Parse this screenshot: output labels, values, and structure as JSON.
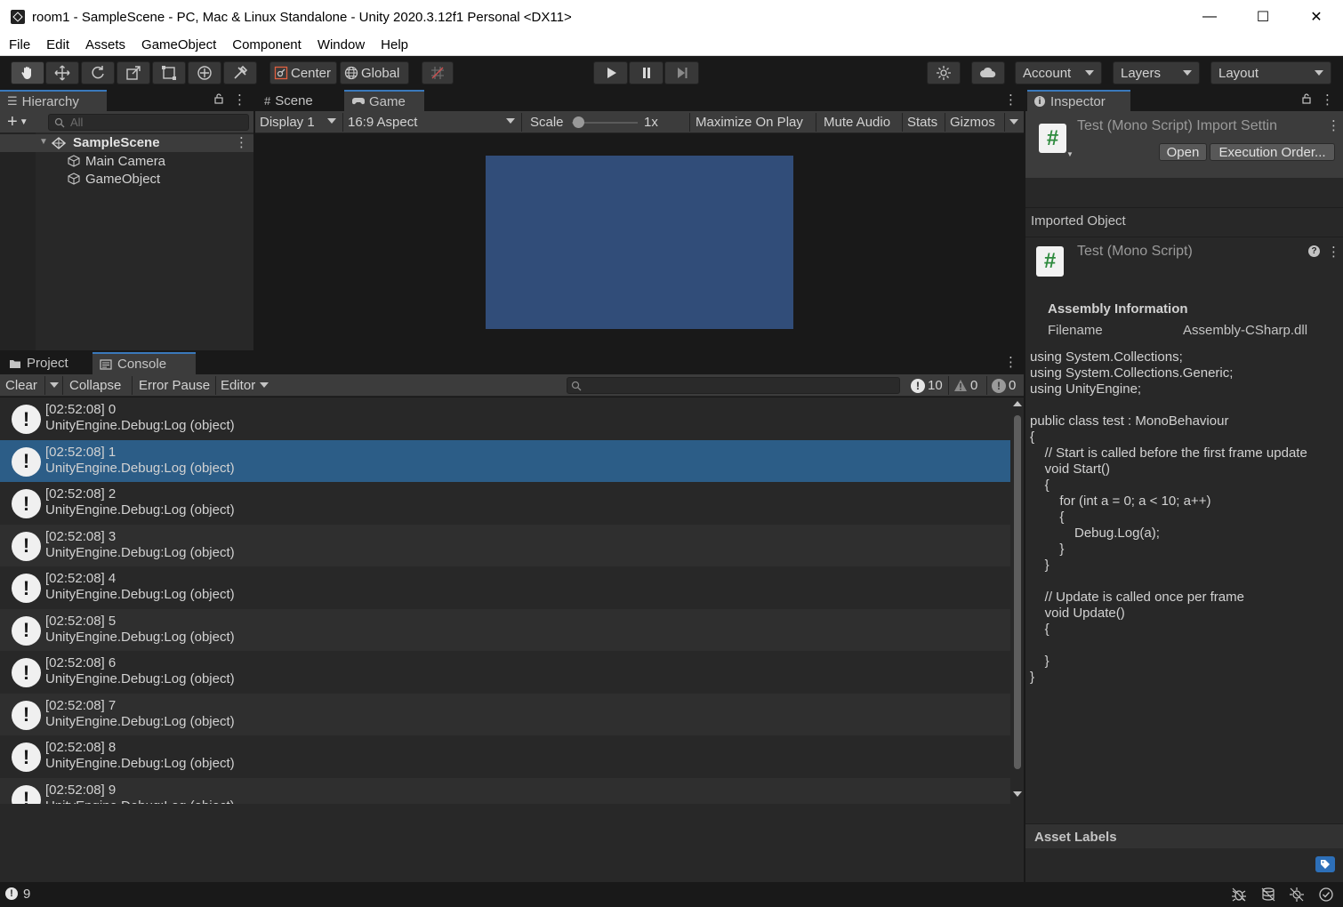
{
  "window": {
    "title": "room1 - SampleScene - PC, Mac & Linux Standalone - Unity 2020.3.12f1 Personal <DX11>",
    "minimize": "—",
    "maximize": "☐",
    "close": "✕"
  },
  "menu": [
    "File",
    "Edit",
    "Assets",
    "GameObject",
    "Component",
    "Window",
    "Help"
  ],
  "toolbar": {
    "pivot_label": "Center",
    "space_label": "Global",
    "account_label": "Account",
    "layers_label": "Layers",
    "layout_label": "Layout"
  },
  "hierarchy": {
    "tab_label": "Hierarchy",
    "search_placeholder": "All",
    "scene_name": "SampleScene",
    "items": [
      "Main Camera",
      "GameObject"
    ]
  },
  "scene_tab": {
    "label": "Scene"
  },
  "game_tab": {
    "label": "Game",
    "display": "Display 1",
    "aspect": "16:9 Aspect",
    "scale_label": "Scale",
    "scale_value": "1x",
    "maximize_on_play": "Maximize On Play",
    "mute_audio": "Mute Audio",
    "stats": "Stats",
    "gizmos": "Gizmos",
    "canvas_color": "#314d79"
  },
  "bottom_tabs": {
    "project": "Project",
    "console": "Console"
  },
  "console": {
    "clear": "Clear",
    "collapse": "Collapse",
    "error_pause": "Error Pause",
    "editor": "Editor",
    "count_info": "10",
    "count_warn": "0",
    "count_error": "0",
    "selected_index": 1,
    "rows": [
      {
        "line1": "[02:52:08] 0",
        "line2": "UnityEngine.Debug:Log (object)"
      },
      {
        "line1": "[02:52:08] 1",
        "line2": "UnityEngine.Debug:Log (object)"
      },
      {
        "line1": "[02:52:08] 2",
        "line2": "UnityEngine.Debug:Log (object)"
      },
      {
        "line1": "[02:52:08] 3",
        "line2": "UnityEngine.Debug:Log (object)"
      },
      {
        "line1": "[02:52:08] 4",
        "line2": "UnityEngine.Debug:Log (object)"
      },
      {
        "line1": "[02:52:08] 5",
        "line2": "UnityEngine.Debug:Log (object)"
      },
      {
        "line1": "[02:52:08] 6",
        "line2": "UnityEngine.Debug:Log (object)"
      },
      {
        "line1": "[02:52:08] 7",
        "line2": "UnityEngine.Debug:Log (object)"
      },
      {
        "line1": "[02:52:08] 8",
        "line2": "UnityEngine.Debug:Log (object)"
      },
      {
        "line1": "[02:52:08] 9",
        "line2": "UnityEngine.Debug:Log (object)"
      }
    ]
  },
  "inspector": {
    "tab_label": "Inspector",
    "header_title": "Test (Mono Script) Import Settin",
    "open_button": "Open",
    "execution_order_button": "Execution Order...",
    "imported_object_label": "Imported Object",
    "script_title": "Test (Mono Script)",
    "assembly_info_label": "Assembly Information",
    "filename_label": "Filename",
    "filename_value": "Assembly-CSharp.dll",
    "code_lines": [
      "using System.Collections;",
      "using System.Collections.Generic;",
      "using UnityEngine;",
      "",
      "public class test : MonoBehaviour",
      "{",
      "    // Start is called before the first frame update",
      "    void Start()",
      "    {",
      "        for (int a = 0; a < 10; a++)",
      "        {",
      "            Debug.Log(a);",
      "        }",
      "    }",
      "",
      "    // Update is called once per frame",
      "    void Update()",
      "    {",
      "",
      "    }",
      "}"
    ],
    "asset_labels": "Asset Labels"
  },
  "statusbar": {
    "message": "9"
  }
}
